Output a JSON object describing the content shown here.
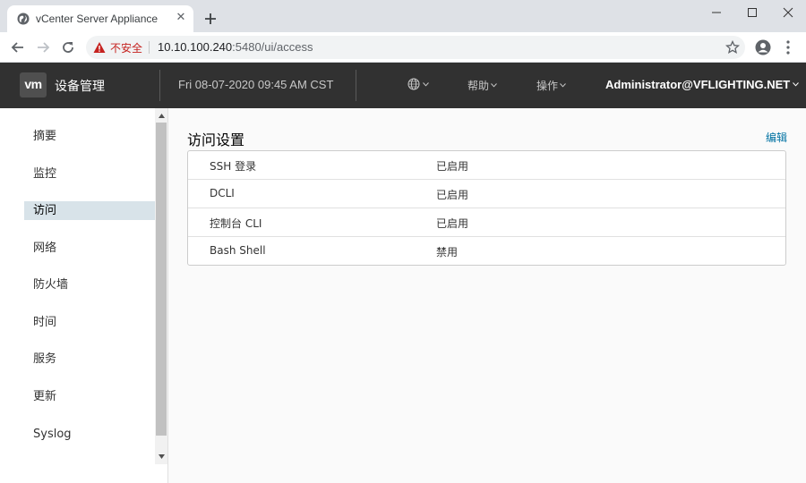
{
  "browser": {
    "tab_title": "vCenter Server Appliance",
    "insecure_label": "不安全",
    "url_host": "10.10.100.240",
    "url_path": ":5480/ui/access"
  },
  "header": {
    "logo_text": "vm",
    "app_title": "设备管理",
    "datetime": "Fri 08-07-2020 09:45 AM CST",
    "help_label": "帮助",
    "actions_label": "操作",
    "user": "Administrator@VFLIGHTING.NET"
  },
  "sidebar": {
    "items": [
      {
        "label": "摘要"
      },
      {
        "label": "监控"
      },
      {
        "label": "访问"
      },
      {
        "label": "网络"
      },
      {
        "label": "防火墙"
      },
      {
        "label": "时间"
      },
      {
        "label": "服务"
      },
      {
        "label": "更新"
      },
      {
        "label": "Syslog"
      }
    ],
    "active_index": 2
  },
  "main": {
    "title": "访问设置",
    "edit_label": "编辑",
    "settings": [
      {
        "name": "SSH 登录",
        "value": "已启用"
      },
      {
        "name": "DCLI",
        "value": "已启用"
      },
      {
        "name": "控制台 CLI",
        "value": "已启用"
      },
      {
        "name": "Bash Shell",
        "value": "禁用"
      }
    ]
  },
  "colors": {
    "header_bg": "#313131",
    "active_item_bg": "#d8e3e9",
    "link": "#0072a3",
    "insecure_red": "#c5221f"
  }
}
